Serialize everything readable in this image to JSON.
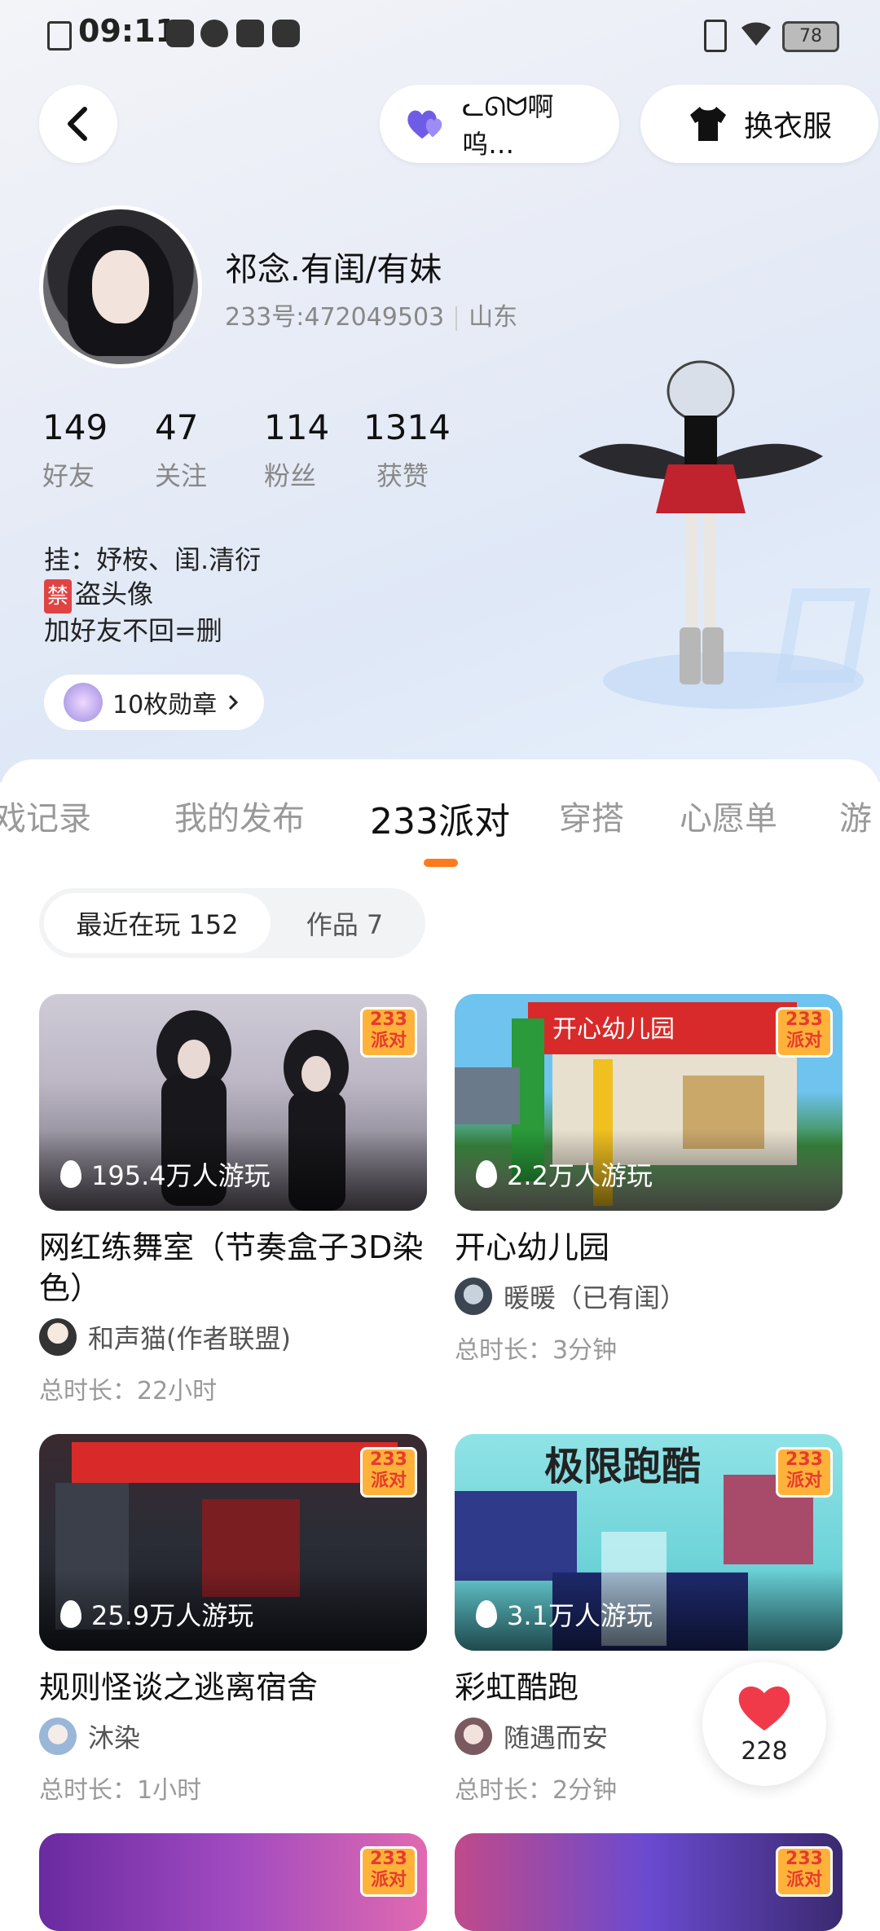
{
  "status_bar": {
    "time": "09:11",
    "battery": "78"
  },
  "header": {
    "partner_name": "ᓚᘏᗢ啊呜…",
    "outfit_label": "换衣服"
  },
  "profile": {
    "nickname": "祁念.有闺/有妹",
    "id": "233号:472049503",
    "region": "山东",
    "stats": [
      {
        "num": "149",
        "label": "好友"
      },
      {
        "num": "47",
        "label": "关注"
      },
      {
        "num": "114",
        "label": "粉丝"
      },
      {
        "num": "1314",
        "label": "获赞"
      }
    ],
    "bio_line1": "挂：妤桉、闺.清衍",
    "bio_ban": "禁",
    "bio_line2": "盗头像",
    "bio_line3": "加好友不回=删",
    "medals": "10枚勋章"
  },
  "tabs": [
    "游戏记录",
    "我的发布",
    "233派对",
    "穿搭",
    "心愿单",
    "游"
  ],
  "active_tab": "233派对",
  "subtabs": {
    "recent": "最近在玩  152",
    "works": "作品  7"
  },
  "tag233": {
    "line1": "233",
    "line2": "派对"
  },
  "cards": [
    {
      "plays": "195.4万人游玩",
      "title": "网红练舞室（节奏盒子3D染色）",
      "author": "和声猫(作者联盟)",
      "duration": "总时长：22小时"
    },
    {
      "plays": "2.2万人游玩",
      "title": "开心幼儿园",
      "author": "暖暖（已有闺）",
      "duration": "总时长：3分钟",
      "sign": "开心幼儿园"
    },
    {
      "plays": "25.9万人游玩",
      "title": "规则怪谈之逃离宿舍",
      "author": "沐染",
      "duration": "总时长：1小时"
    },
    {
      "plays": "3.1万人游玩",
      "title": "彩虹酷跑",
      "author": "随遇而安",
      "duration": "总时长：2分钟",
      "banner": "极限跑酷"
    }
  ],
  "like_count": "228"
}
